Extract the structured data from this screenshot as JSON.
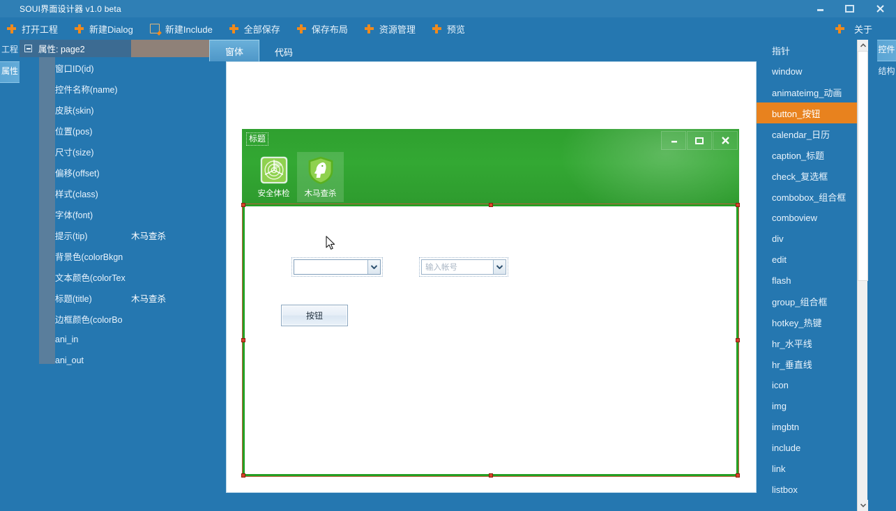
{
  "window": {
    "title": "SOUI界面设计器 v1.0 beta",
    "controls": [
      {
        "name": "minimize",
        "icon": "minimize-icon"
      },
      {
        "name": "maximize",
        "icon": "maximize-icon"
      },
      {
        "name": "close",
        "icon": "close-icon"
      }
    ]
  },
  "toolbar": {
    "items": [
      {
        "label": "打开工程",
        "icon": "plus-icon"
      },
      {
        "label": "新建Dialog",
        "icon": "plus-icon"
      },
      {
        "label": "新建Include",
        "icon": "new-document-icon"
      },
      {
        "label": "全部保存",
        "icon": "plus-icon"
      },
      {
        "label": "保存布局",
        "icon": "plus-icon"
      },
      {
        "label": "资源管理",
        "icon": "plus-icon"
      },
      {
        "label": "预览",
        "icon": "plus-icon"
      }
    ],
    "right": {
      "label": "关于",
      "icon": "plus-icon"
    }
  },
  "left_tabs": [
    {
      "label": "工程",
      "active": false
    },
    {
      "label": "属性",
      "active": true
    }
  ],
  "right_tabs": [
    {
      "label": "控件",
      "active": true
    },
    {
      "label": "结构",
      "active": false
    }
  ],
  "properties": {
    "header": "属性: page2",
    "rows": [
      {
        "name": "窗口ID(id)",
        "value": ""
      },
      {
        "name": "控件名称(name)",
        "value": ""
      },
      {
        "name": "皮肤(skin)",
        "value": ""
      },
      {
        "name": "位置(pos)",
        "value": ""
      },
      {
        "name": "尺寸(size)",
        "value": ""
      },
      {
        "name": "偏移(offset)",
        "value": ""
      },
      {
        "name": "样式(class)",
        "value": ""
      },
      {
        "name": "字体(font)",
        "value": ""
      },
      {
        "name": "提示(tip)",
        "value": "木马查杀"
      },
      {
        "name": "背景色(colorBkgn",
        "value": ""
      },
      {
        "name": "文本颜色(colorTex",
        "value": ""
      },
      {
        "name": "标题(title)",
        "value": "木马查杀"
      },
      {
        "name": "边框颜色(colorBo",
        "value": ""
      },
      {
        "name": "ani_in",
        "value": ""
      },
      {
        "name": "ani_out",
        "value": ""
      }
    ]
  },
  "editor": {
    "tabs": [
      {
        "label": "窗体",
        "active": true
      },
      {
        "label": "代码",
        "active": false
      }
    ]
  },
  "design": {
    "caption": "标题",
    "window_buttons": [
      {
        "name": "minimize",
        "icon": "minimize-icon"
      },
      {
        "name": "maximize",
        "icon": "maximize-icon"
      },
      {
        "name": "close",
        "icon": "close-icon"
      }
    ],
    "tabs": [
      {
        "label": "安全体检",
        "icon": "radar-scan-icon",
        "selected": false
      },
      {
        "label": "木马查杀",
        "icon": "shield-horse-icon",
        "selected": true
      }
    ],
    "widgets": {
      "combobox_left": {
        "value": "",
        "placeholder": ""
      },
      "combobox_right": {
        "value": "",
        "placeholder": "输入帐号"
      },
      "button": {
        "label": "按钮"
      }
    }
  },
  "controls_panel": {
    "items": [
      {
        "label": "指针",
        "active": false
      },
      {
        "label": "window",
        "active": false
      },
      {
        "label": "animateimg_动画",
        "active": false
      },
      {
        "label": "button_按钮",
        "active": true
      },
      {
        "label": "calendar_日历",
        "active": false
      },
      {
        "label": "caption_标题",
        "active": false
      },
      {
        "label": "check_复选框",
        "active": false
      },
      {
        "label": "combobox_组合框",
        "active": false
      },
      {
        "label": "comboview",
        "active": false
      },
      {
        "label": "div",
        "active": false
      },
      {
        "label": "edit",
        "active": false
      },
      {
        "label": "flash",
        "active": false
      },
      {
        "label": "group_组合框",
        "active": false
      },
      {
        "label": "hotkey_热键",
        "active": false
      },
      {
        "label": "hr_水平线",
        "active": false
      },
      {
        "label": "hr_垂直线",
        "active": false
      },
      {
        "label": "icon",
        "active": false
      },
      {
        "label": "img",
        "active": false
      },
      {
        "label": "imgbtn",
        "active": false
      },
      {
        "label": "include",
        "active": false
      },
      {
        "label": "link",
        "active": false
      },
      {
        "label": "listbox",
        "active": false
      }
    ]
  },
  "colors": {
    "chrome_blue": "#2577b0",
    "accent_orange": "#e8821e",
    "plus_orange": "#f08a1d",
    "design_green": "#33a833",
    "selection_red": "#d7452b"
  }
}
